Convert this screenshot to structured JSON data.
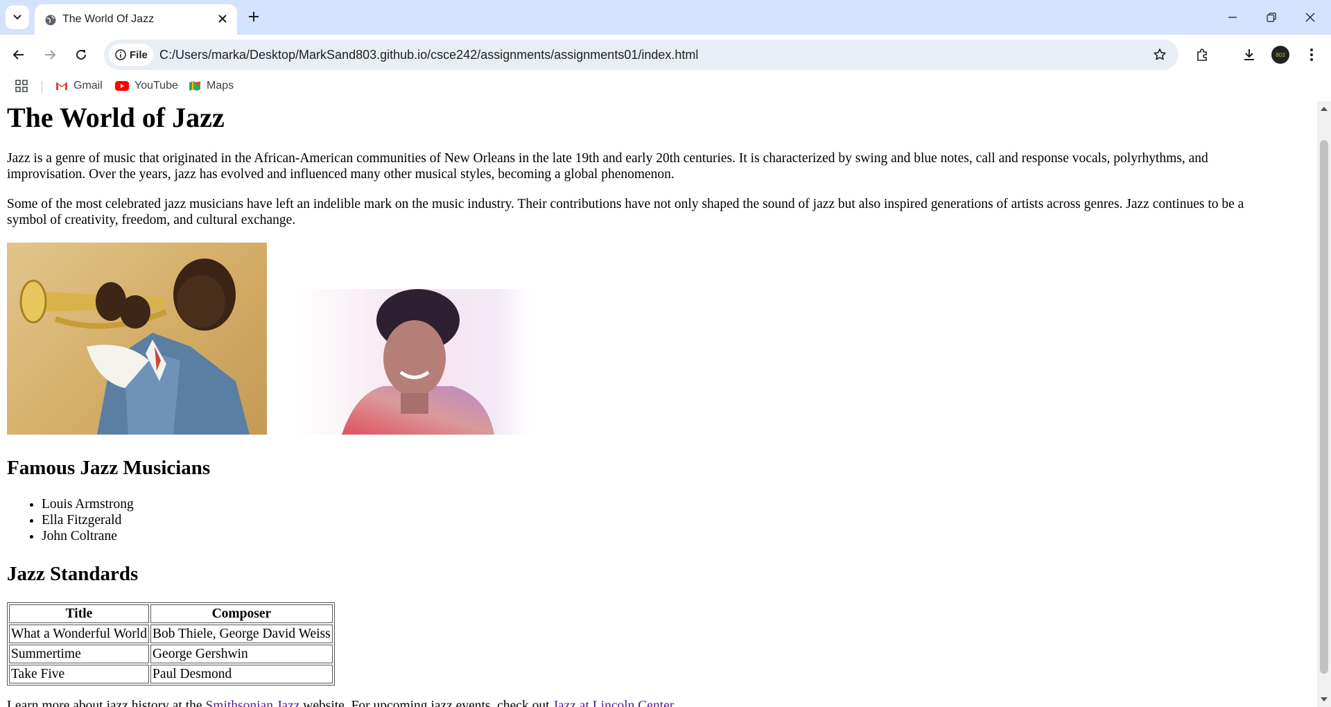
{
  "browser": {
    "tab_title": "The World Of Jazz",
    "url_chip": "File",
    "url": "C:/Users/marka/Desktop/MarkSand803.github.io/csce242/assignments/assignments01/index.html",
    "avatar_text": "803",
    "bookmarks": [
      "Gmail",
      "YouTube",
      "Maps"
    ]
  },
  "page": {
    "title": "The World of Jazz",
    "intro": "Jazz is a genre of music that originated in the African-American communities of New Orleans in the late 19th and early 20th centuries. It is characterized by swing and blue notes, call and response vocals, polyrhythms, and improvisation. Over the years, jazz has evolved and influenced many other musical styles, becoming a global phenomenon.",
    "paragraph2": "Some of the most celebrated jazz musicians have left an indelible mark on the music industry. Their contributions have not only shaped the sound of jazz but also inspired generations of artists across genres. Jazz continues to be a symbol of creativity, freedom, and cultural exchange.",
    "musicians_heading": "Famous Jazz Musicians",
    "musicians": [
      "Louis Armstrong",
      "Ella Fitzgerald",
      "John Coltrane"
    ],
    "standards_heading": "Jazz Standards",
    "table": {
      "headers": [
        "Title",
        "Composer"
      ],
      "rows": [
        [
          "What a Wonderful World",
          "Bob Thiele, George David Weiss"
        ],
        [
          "Summertime",
          "George Gershwin"
        ],
        [
          "Take Five",
          "Paul Desmond"
        ]
      ]
    },
    "footer": {
      "text1": "Learn more about jazz history at the ",
      "link1": "Smithsonian Jazz",
      "text2": " website. For upcoming jazz events, check out ",
      "link2": "Jazz at Lincoln Center",
      "text3": "."
    }
  },
  "colors": {
    "tabstrip": "#d3e3fd",
    "omnibox": "#e9eef6",
    "visited_link": "#551a8b"
  }
}
